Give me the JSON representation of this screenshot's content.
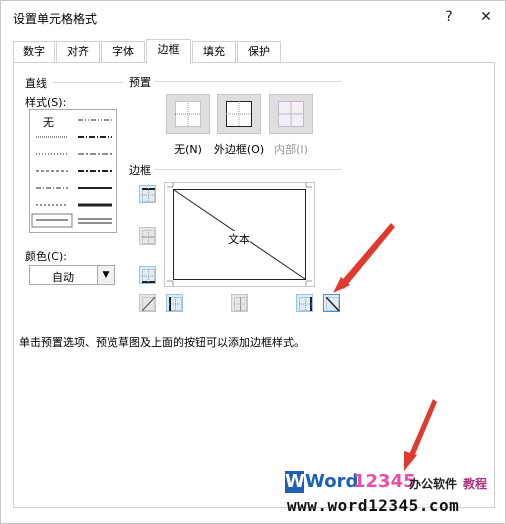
{
  "dialog": {
    "title": "设置单元格格式",
    "help_label": "?",
    "close_label": "✕"
  },
  "tabs": [
    {
      "label": "数字",
      "active": false
    },
    {
      "label": "对齐",
      "active": false
    },
    {
      "label": "字体",
      "active": false
    },
    {
      "label": "边框",
      "active": true
    },
    {
      "label": "填充",
      "active": false
    },
    {
      "label": "保护",
      "active": false
    }
  ],
  "line": {
    "group_label": "直线",
    "style_label": "样式(S):",
    "none_label": "无",
    "color_label": "颜色(C):",
    "color_value": "自动"
  },
  "presets": {
    "group_label": "预置",
    "items": [
      {
        "label": "无(N)",
        "enabled": true
      },
      {
        "label": "外边框(O)",
        "enabled": true
      },
      {
        "label": "内部(I)",
        "enabled": false
      }
    ]
  },
  "border": {
    "group_label": "边框",
    "preview_text": "文本"
  },
  "hint": "单击预置选项、预览草图及上面的按钮可以添加边框样式。",
  "watermark": {
    "brand_word": "Word",
    "brand_digits": "12345",
    "brand_cn": "办公软件",
    "brand_tag": "教程",
    "url": "www.word12345.com"
  },
  "colors": {
    "accent_button_bg": "#ddeefb",
    "accent_button_border": "#9cc3e6",
    "arrow": "#e03a30"
  }
}
